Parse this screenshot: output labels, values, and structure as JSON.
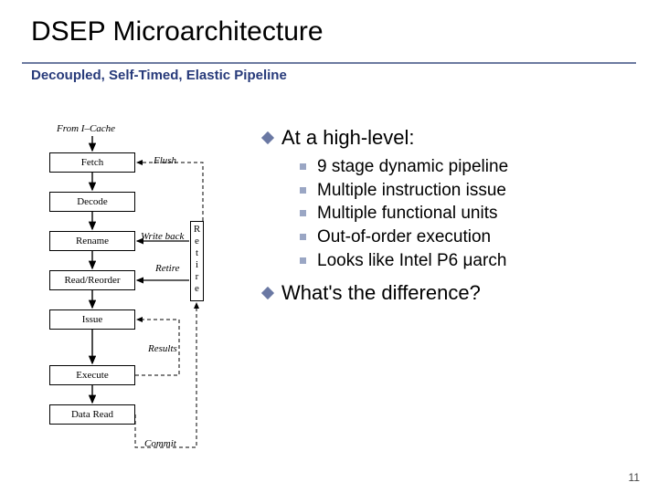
{
  "title": "DSEP Microarchitecture",
  "subtitle": "Decoupled, Self-Timed, Elastic Pipeline",
  "diagram": {
    "from_label": "From I–Cache",
    "stages": [
      "Fetch",
      "Decode",
      "Rename",
      "Read/Reorder",
      "Issue",
      "Execute",
      "Data Read"
    ],
    "edge_labels": {
      "flush": "Flush",
      "writeback": "Write back",
      "retire_label": "Retire",
      "retire_vertical": "R\ne\nt\ni\nr\ne",
      "results": "Results",
      "commit": "Commit"
    }
  },
  "headings": {
    "high_level": "At a high-level:",
    "difference": "What's the difference?"
  },
  "bullets": [
    "9 stage dynamic pipeline",
    "Multiple instruction issue",
    "Multiple functional units",
    "Out-of-order execution",
    "Looks like Intel P6 μarch"
  ],
  "page_number": "11"
}
